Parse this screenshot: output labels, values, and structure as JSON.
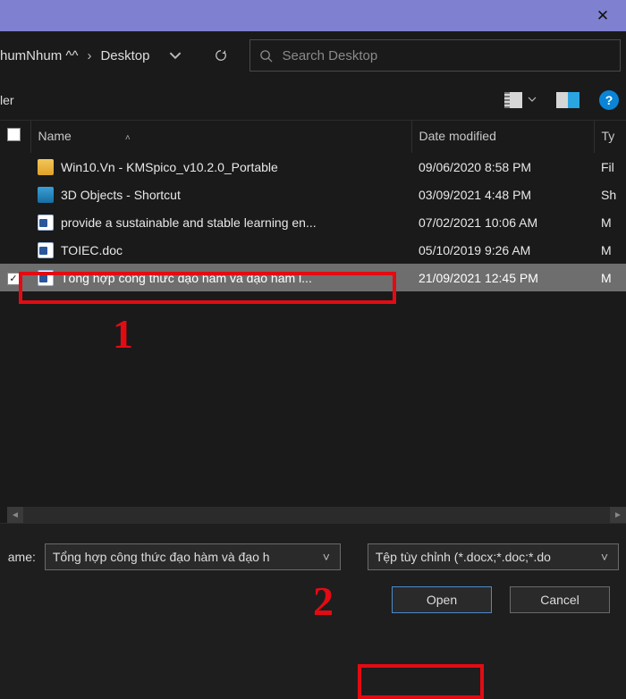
{
  "titlebar": {
    "close_glyph": "✕"
  },
  "nav": {
    "crumb1": "humNhum ^^",
    "crumb2": "Desktop",
    "search_placeholder": "Search Desktop"
  },
  "toolbar": {
    "left_fragment": "ler",
    "help_glyph": "?"
  },
  "columns": {
    "name": "Name",
    "date": "Date modified",
    "type": "Ty"
  },
  "rows": [
    {
      "check": "",
      "icon": "folder",
      "name": "Win10.Vn - KMSpico_v10.2.0_Portable",
      "date": "09/06/2020 8:58 PM",
      "type": "Fil",
      "selected": false
    },
    {
      "check": "",
      "icon": "3d",
      "name": "3D Objects - Shortcut",
      "date": "03/09/2021 4:48 PM",
      "type": "Sh",
      "selected": false
    },
    {
      "check": "",
      "icon": "doc",
      "name": "provide a sustainable and stable learning en...",
      "date": "07/02/2021 10:06 AM",
      "type": "M",
      "selected": false
    },
    {
      "check": "",
      "icon": "doc",
      "name": "TOIEC.doc",
      "date": "05/10/2019 9:26 AM",
      "type": "M",
      "selected": false
    },
    {
      "check": "✓",
      "icon": "doc",
      "name": "Tổng hợp công thức đạo hàm và đạo hàm l...",
      "date": "21/09/2021 12:45 PM",
      "type": "M",
      "selected": true
    }
  ],
  "footer": {
    "filename_label": "ame:",
    "filename_value": "Tổng hợp công thức đạo hàm và đạo h",
    "filter_value": "Tệp tùy chỉnh (*.docx;*.doc;*.do",
    "open_label": "Open",
    "cancel_label": "Cancel"
  },
  "annotations": {
    "one": "1",
    "two": "2"
  }
}
